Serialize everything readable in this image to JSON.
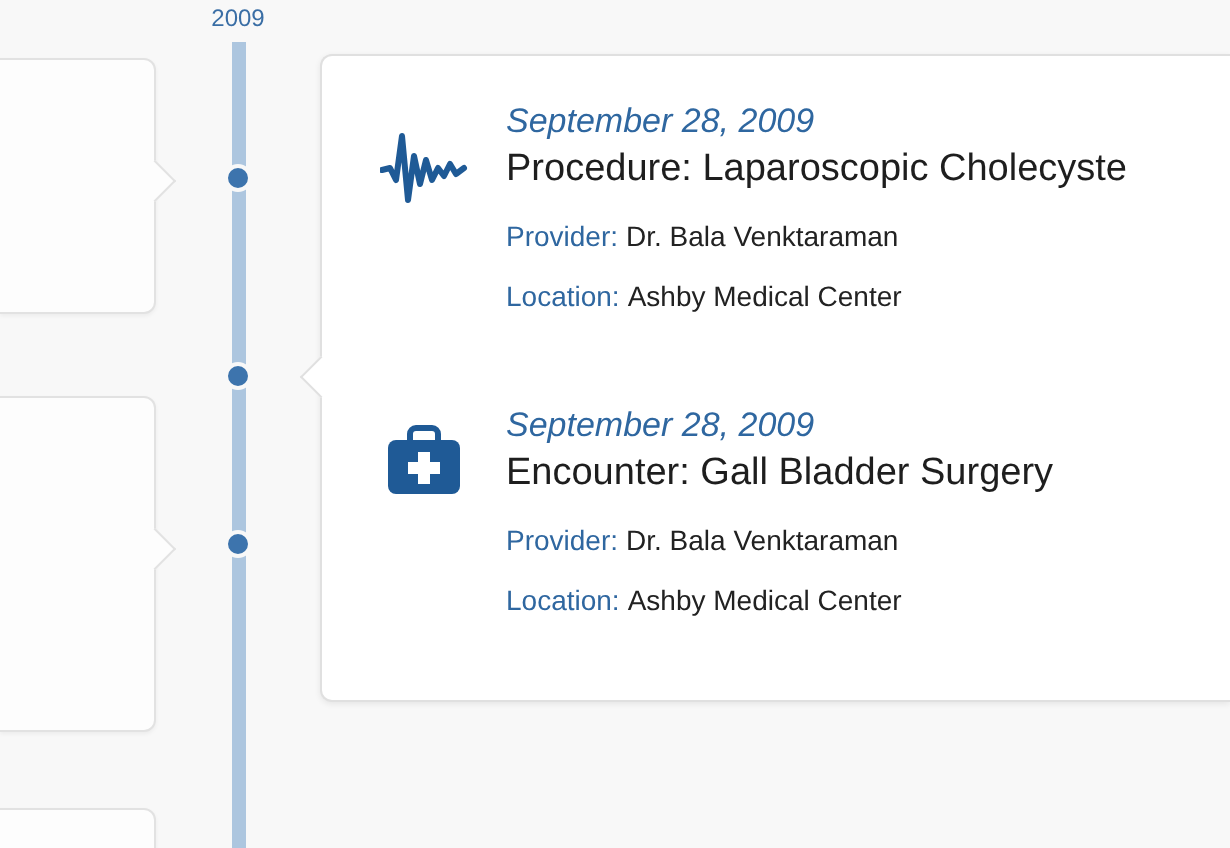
{
  "timeline": {
    "year": "2009"
  },
  "events": [
    {
      "kind": "procedure",
      "date": "September 28, 2009",
      "title": "Procedure: Laparoscopic Cholecyste",
      "details": [
        {
          "label": "Provider:",
          "value": "Dr. Bala Venktaraman"
        },
        {
          "label": "Location:",
          "value": "Ashby Medical Center"
        }
      ]
    },
    {
      "kind": "encounter",
      "date": "September 28, 2009",
      "title": "Encounter: Gall Bladder Surgery",
      "details": [
        {
          "label": "Provider:",
          "value": "Dr. Bala Venktaraman"
        },
        {
          "label": "Location:",
          "value": "Ashby Medical Center"
        }
      ]
    }
  ]
}
